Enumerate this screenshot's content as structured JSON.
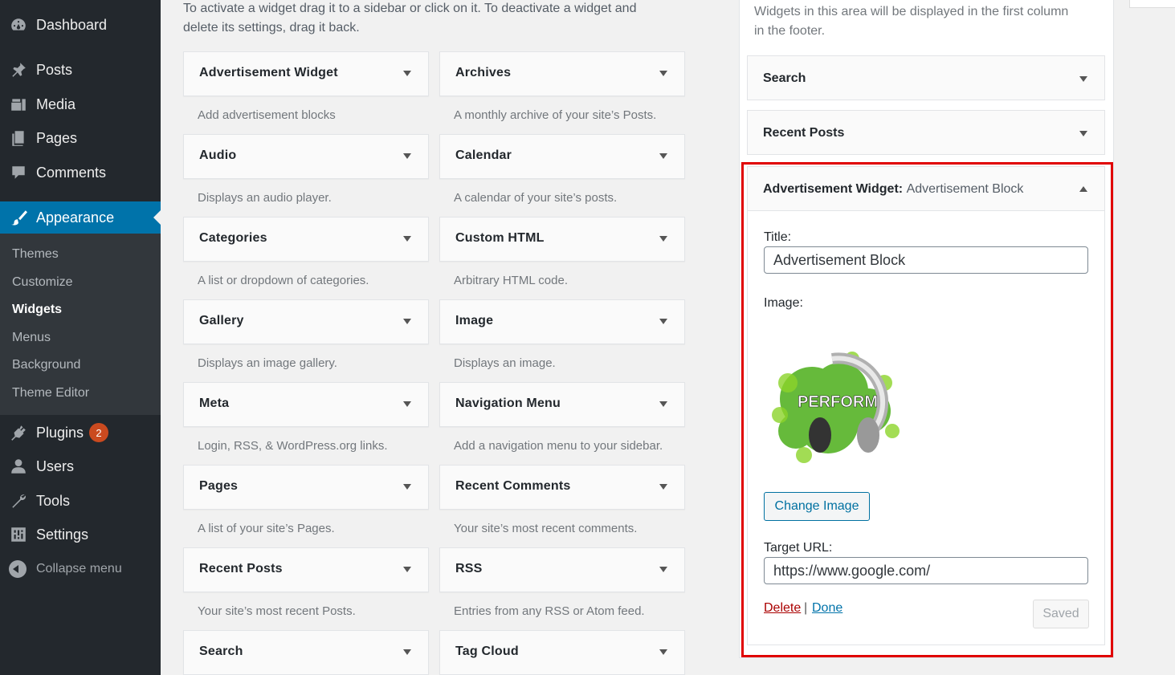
{
  "menu": {
    "items": [
      {
        "label": "Dashboard",
        "icon": "dashboard-icon"
      },
      {
        "label": "Posts",
        "icon": "pin-icon"
      },
      {
        "label": "Media",
        "icon": "media-icon"
      },
      {
        "label": "Pages",
        "icon": "pages-icon"
      },
      {
        "label": "Comments",
        "icon": "comments-icon"
      },
      {
        "label": "Appearance",
        "icon": "paintbrush-icon",
        "current": true
      },
      {
        "label": "Plugins",
        "icon": "plugin-icon",
        "badge": "2"
      },
      {
        "label": "Users",
        "icon": "users-icon"
      },
      {
        "label": "Tools",
        "icon": "wrench-icon"
      },
      {
        "label": "Settings",
        "icon": "settings-icon"
      }
    ],
    "submenu": [
      "Themes",
      "Customize",
      "Widgets",
      "Menus",
      "Background",
      "Theme Editor"
    ],
    "submenu_current": "Widgets",
    "collapse_label": "Collapse menu"
  },
  "available": {
    "intro": "To activate a widget drag it to a sidebar or click on it. To deactivate a widget and delete its settings, drag it back.",
    "widgets": [
      {
        "title": "Advertisement Widget",
        "desc": "Add advertisement blocks"
      },
      {
        "title": "Archives",
        "desc": "A monthly archive of your site’s Posts."
      },
      {
        "title": "Audio",
        "desc": "Displays an audio player."
      },
      {
        "title": "Calendar",
        "desc": "A calendar of your site’s posts."
      },
      {
        "title": "Categories",
        "desc": "A list or dropdown of categories."
      },
      {
        "title": "Custom HTML",
        "desc": "Arbitrary HTML code."
      },
      {
        "title": "Gallery",
        "desc": "Displays an image gallery."
      },
      {
        "title": "Image",
        "desc": "Displays an image."
      },
      {
        "title": "Meta",
        "desc": "Login, RSS, & WordPress.org links."
      },
      {
        "title": "Navigation Menu",
        "desc": "Add a navigation menu to your sidebar."
      },
      {
        "title": "Pages",
        "desc": "A list of your site’s Pages."
      },
      {
        "title": "Recent Comments",
        "desc": "Your site’s most recent comments."
      },
      {
        "title": "Recent Posts",
        "desc": "Your site’s most recent Posts."
      },
      {
        "title": "RSS",
        "desc": "Entries from any RSS or Atom feed."
      },
      {
        "title": "Search",
        "desc": ""
      },
      {
        "title": "Tag Cloud",
        "desc": ""
      }
    ]
  },
  "sidebar": {
    "description": "Widgets in this area will be displayed in the first column in the footer.",
    "widgets": [
      "Search",
      "Recent Posts"
    ],
    "open_widget": {
      "name": "Advertisement Widget",
      "instance_title": "Advertisement Block",
      "title_label": "Title:",
      "title_value": "Advertisement Block",
      "image_label": "Image:",
      "image_text": "PERFORM",
      "change_image_label": "Change Image",
      "target_url_label": "Target URL:",
      "target_url_value": "https://www.google.com/",
      "delete_label": "Delete",
      "separator": "|",
      "done_label": "Done",
      "saved_label": "Saved"
    }
  },
  "colors": {
    "menu_bg": "#23282d",
    "submenu_bg": "#32373c",
    "accent": "#0073aa",
    "badge": "#ca4a1f",
    "highlight": "#e00000"
  }
}
